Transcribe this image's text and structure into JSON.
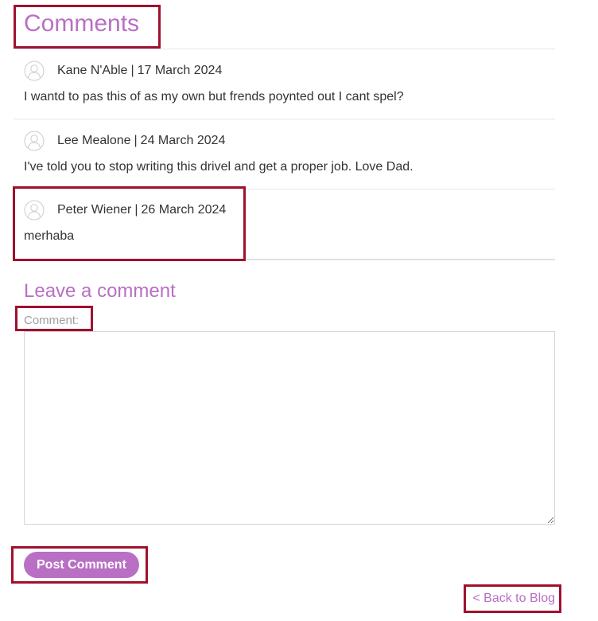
{
  "colors": {
    "accent": "#b96fc4",
    "highlight_box": "#a0112e"
  },
  "header": {
    "title": "Comments"
  },
  "comments": [
    {
      "author": "Kane N'Able",
      "separator": "|",
      "date": "17 March 2024",
      "body": "I wantd to pas this of as my own but frends poynted out I cant spel?",
      "avatar_icon": "user-avatar-icon"
    },
    {
      "author": "Lee Mealone",
      "separator": "|",
      "date": "24 March 2024",
      "body": "I've told you to stop writing this drivel and get a proper job. Love Dad.",
      "avatar_icon": "user-avatar-icon"
    },
    {
      "author": "Peter Wiener",
      "separator": "|",
      "date": "26 March 2024",
      "body": "merhaba",
      "avatar_icon": "user-avatar-icon"
    }
  ],
  "form": {
    "title": "Leave a comment",
    "comment_label": "Comment:",
    "comment_value": "",
    "submit_label": "Post Comment"
  },
  "footer": {
    "back_link": "< Back to Blog"
  }
}
